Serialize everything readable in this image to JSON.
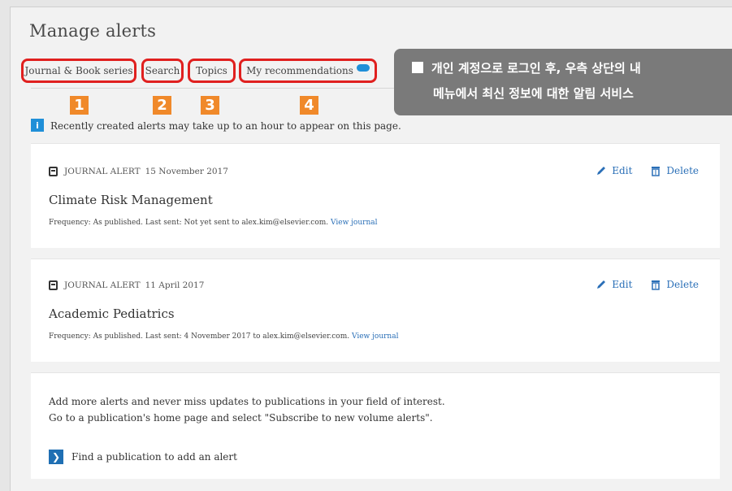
{
  "page": {
    "title": "Manage alerts"
  },
  "tabs": [
    {
      "label": "Journal & Book series"
    },
    {
      "label": "Search"
    },
    {
      "label": "Topics"
    },
    {
      "label": "My recommendations"
    }
  ],
  "callout_numbers": [
    "1",
    "2",
    "3",
    "4"
  ],
  "banner": {
    "line1": "개인 계정으로 로그인 후, 우측 상단의 내",
    "line2": "메뉴에서 최신 정보에 대한 알림 서비스"
  },
  "notice": {
    "text": "Recently created alerts may take up to an hour to appear on this page."
  },
  "alerts": [
    {
      "type": "JOURNAL ALERT",
      "date": "15 November 2017",
      "title": "Climate Risk Management",
      "meta": "Frequency: As published.  Last sent: Not yet sent to alex.kim@elsevier.com.",
      "link": "View journal"
    },
    {
      "type": "JOURNAL ALERT",
      "date": "11 April 2017",
      "title": "Academic Pediatrics",
      "meta": "Frequency: As published.  Last sent: 4 November 2017 to alex.kim@elsevier.com.",
      "link": "View journal"
    }
  ],
  "actions": {
    "edit": "Edit",
    "delete": "Delete"
  },
  "cta": {
    "line1": "Add more alerts and never miss updates to publications in your field of interest.",
    "line2": "Go to a publication's home page and select \"Subscribe to new volume alerts\".",
    "button": "Find a publication to add an alert"
  },
  "colors": {
    "highlight": "#e0201f",
    "callout": "#f0892a",
    "link": "#2a6fb7",
    "banner": "#7a7a7a"
  },
  "icons": [
    "info-icon",
    "document-icon",
    "pencil-icon",
    "trash-icon",
    "chevron-right-icon"
  ]
}
